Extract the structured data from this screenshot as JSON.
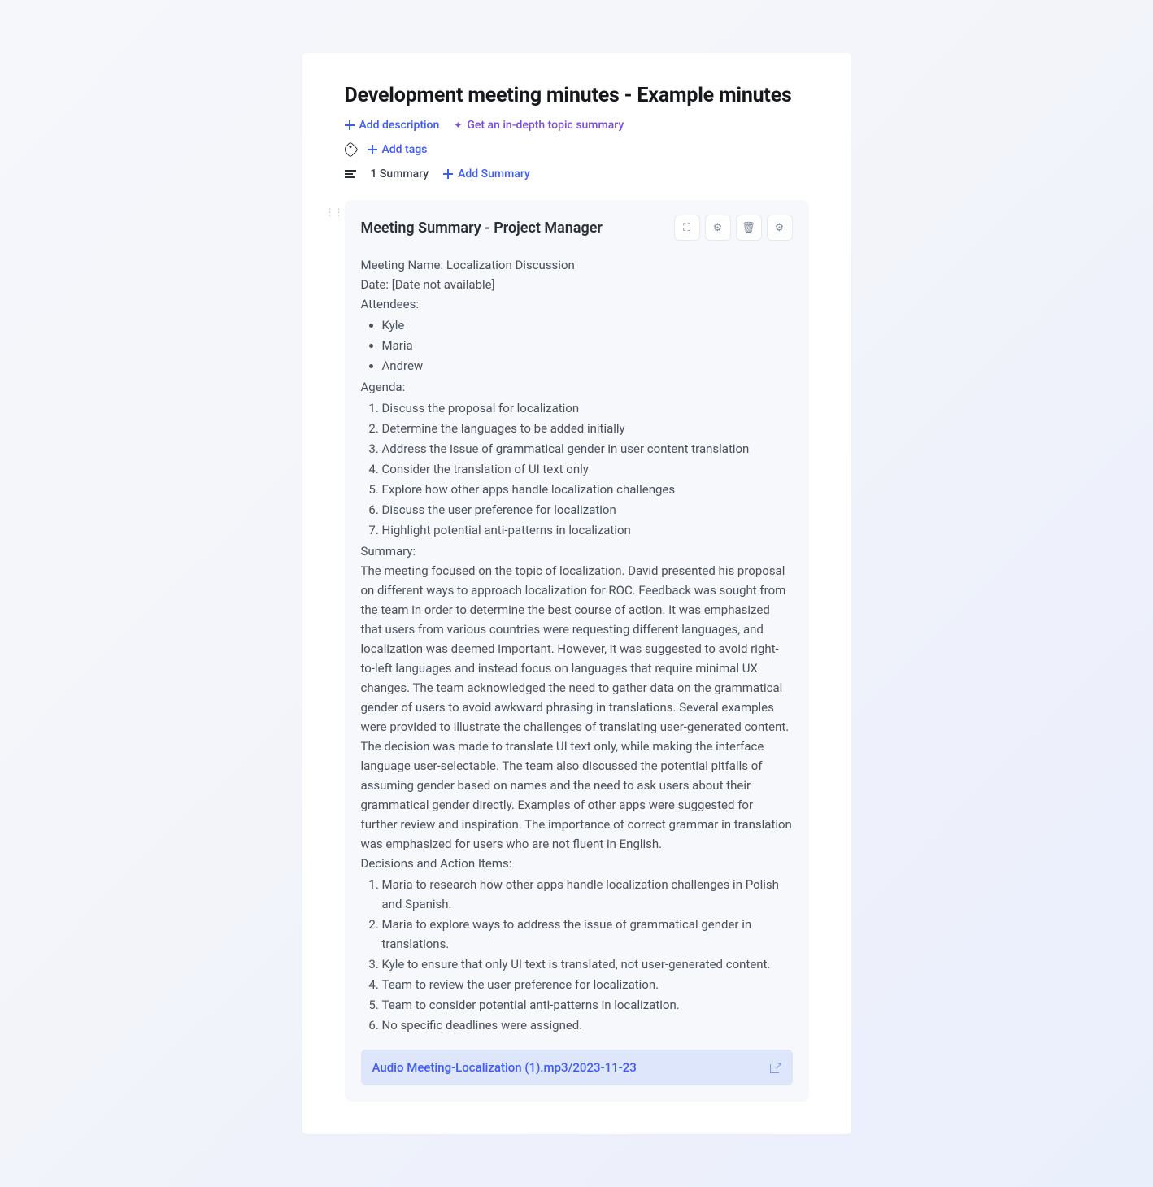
{
  "page": {
    "title": "Development meeting minutes - Example minutes",
    "actions": {
      "add_description": "Add description",
      "ai_summary": "Get an in-depth topic summary",
      "add_tags": "Add tags"
    },
    "summary_meta": {
      "count_label": "1 Summary",
      "add_summary": "Add Summary"
    }
  },
  "summary": {
    "title": "Meeting Summary - Project Manager",
    "meeting_name_label": "Meeting Name: ",
    "meeting_name": "Localization Discussion",
    "date_label": "Date: ",
    "date": "[Date not available]",
    "attendees_label": "Attendees:",
    "attendees": [
      "Kyle",
      "Maria",
      "Andrew"
    ],
    "agenda_label": "Agenda:",
    "agenda": [
      "Discuss the proposal for localization",
      "Determine the languages to be added initially",
      "Address the issue of grammatical gender in user content translation",
      "Consider the translation of UI text only",
      "Explore how other apps handle localization challenges",
      "Discuss the user preference for localization",
      "Highlight potential anti-patterns in localization"
    ],
    "summary_label": "Summary:",
    "summary_text": "The meeting focused on the topic of localization. David presented his proposal on different ways to approach localization for ROC. Feedback was sought from the team in order to determine the best course of action. It was emphasized that users from various countries were requesting different languages, and localization was deemed important. However, it was suggested to avoid right-to-left languages and instead focus on languages that require minimal UX changes. The team acknowledged the need to gather data on the grammatical gender of users to avoid awkward phrasing in translations. Several examples were provided to illustrate the challenges of translating user-generated content. The decision was made to translate UI text only, while making the interface language user-selectable. The team also discussed the potential pitfalls of assuming gender based on names and the need to ask users about their grammatical gender directly. Examples of other apps were suggested for further review and inspiration. The importance of correct grammar in translation was emphasized for users who are not fluent in English.",
    "decisions_label": "Decisions and Action Items:",
    "decisions": [
      "Maria to research how other apps handle localization challenges in Polish and Spanish.",
      "Maria to explore ways to address the issue of grammatical gender in translations.",
      "Kyle to ensure that only UI text is translated, not user-generated content.",
      "Team to review the user preference for localization.",
      "Team to consider potential anti-patterns in localization.",
      "No specific deadlines were assigned."
    ],
    "attachment": "Audio Meeting-Localization (1).mp3/2023-11-23"
  }
}
